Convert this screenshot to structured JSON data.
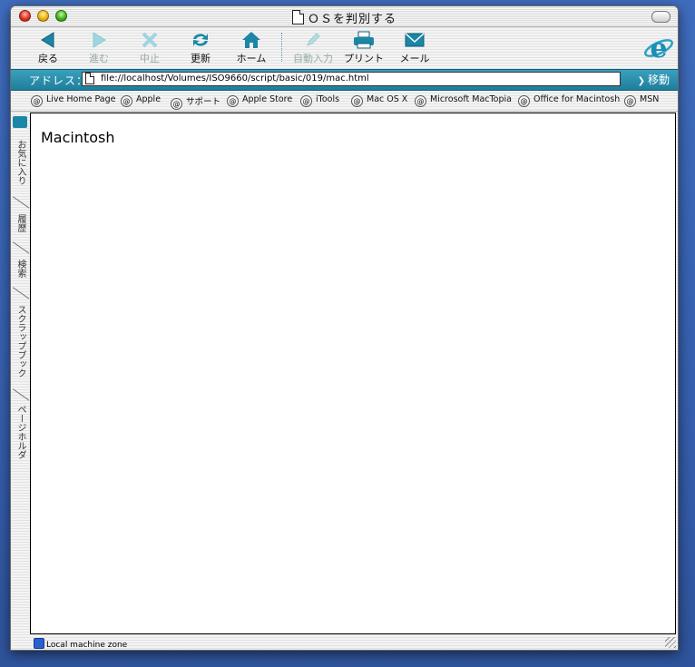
{
  "window": {
    "title": "ＯＳを判別する"
  },
  "toolbar": {
    "back": "戻る",
    "forward": "進む",
    "stop": "中止",
    "refresh": "更新",
    "home": "ホーム",
    "autofill": "自動入力",
    "print": "プリント",
    "mail": "メール"
  },
  "address": {
    "label": "アドレス：",
    "url": "file://localhost/Volumes/ISO9660/script/basic/019/mac.html",
    "go": "移動"
  },
  "favorites": [
    "Live Home Page",
    "Apple",
    "サポート",
    "Apple Store",
    "iTools",
    "Mac OS X",
    "Microsoft MacTopia",
    "Office for Macintosh",
    "MSN"
  ],
  "sidebar": {
    "tabs": [
      "お気に入り",
      "履歴",
      "検索",
      "スクラップブック",
      "ページホルダ"
    ]
  },
  "page": {
    "heading": "Macintosh"
  },
  "status": {
    "zone": "Local machine zone"
  },
  "colors": {
    "accent": "#1d7f9c",
    "desktop": "#3f67b8"
  }
}
